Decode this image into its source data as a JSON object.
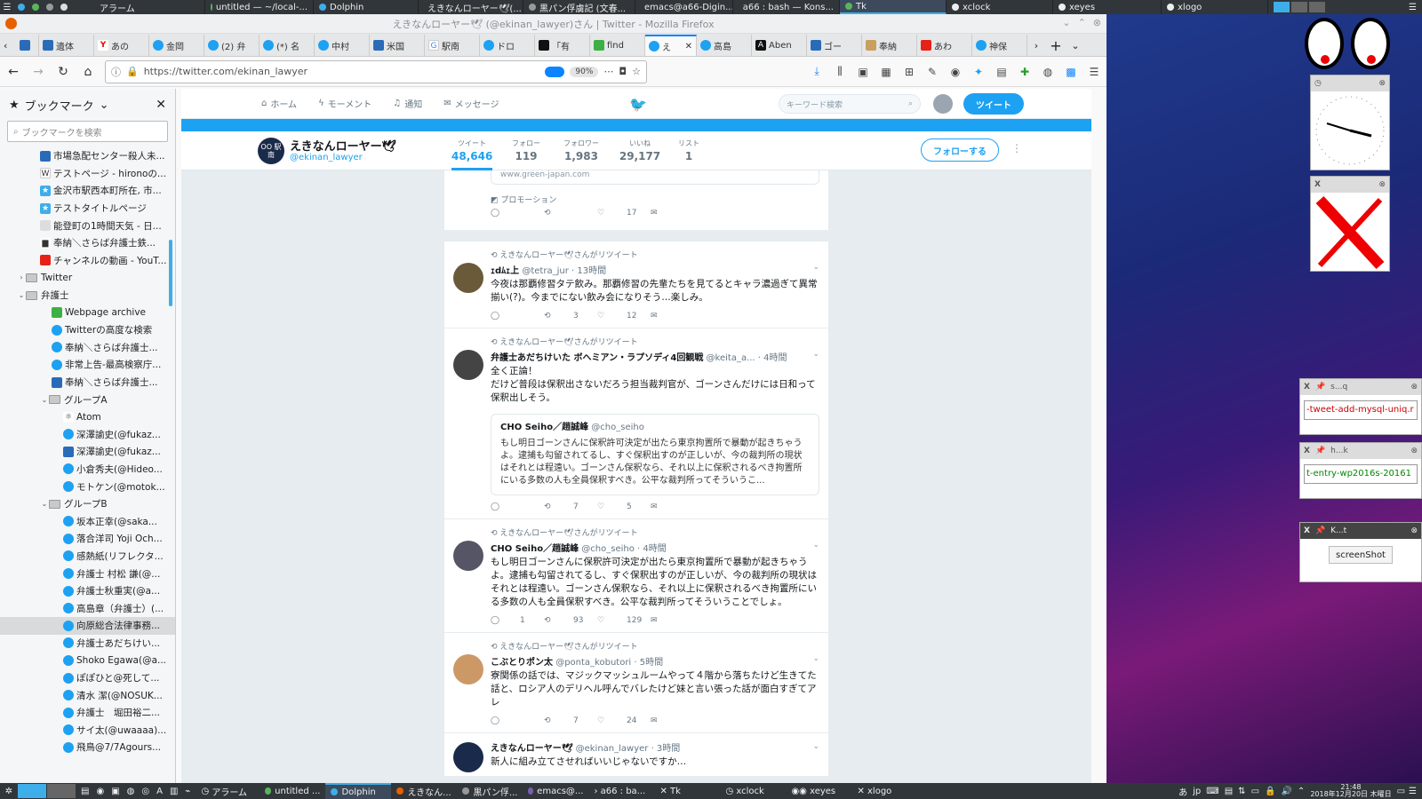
{
  "top_panel": {
    "tasks": [
      {
        "label": "アラーム"
      },
      {
        "label": "untitled — ~/local-..."
      },
      {
        "label": "Dolphin"
      },
      {
        "label": "えきなんローヤー🕊(..."
      },
      {
        "label": "黒パン俘虜記 (文春..."
      },
      {
        "label": "emacs@a66-Digin..."
      },
      {
        "label": "a66 : bash — Kons..."
      },
      {
        "label": "Tk"
      },
      {
        "label": "xclock"
      },
      {
        "label": "xeyes"
      },
      {
        "label": "xlogo"
      }
    ]
  },
  "firefox": {
    "title": "えきなんローヤー🕊 (@ekinan_lawyer)さん | Twitter - Mozilla Firefox",
    "tabs": [
      {
        "label": "遺体"
      },
      {
        "label": "あの"
      },
      {
        "label": "金岡"
      },
      {
        "label": "(2) 弁"
      },
      {
        "label": "(*) 名"
      },
      {
        "label": "中村"
      },
      {
        "label": "米国"
      },
      {
        "label": "駅南"
      },
      {
        "label": "ドロ"
      },
      {
        "label": "「有"
      },
      {
        "label": "find"
      },
      {
        "label": "え"
      },
      {
        "label": "高島"
      },
      {
        "label": "Aben"
      },
      {
        "label": "ゴー"
      },
      {
        "label": "奉納"
      },
      {
        "label": "あわ"
      },
      {
        "label": "神保"
      }
    ],
    "url": "https://twitter.com/ekinan_lawyer",
    "zoom": "90%"
  },
  "sidebar": {
    "title": "ブックマーク",
    "search_placeholder": "ブックマークを検索",
    "items": [
      {
        "label": "市場急配センター殺人未..."
      },
      {
        "label": "テストページ - hironoの..."
      },
      {
        "label": "金沢市駅西本町所在, 市..."
      },
      {
        "label": "テストタイトルページ"
      },
      {
        "label": "能登町の1時間天気 - 日..."
      },
      {
        "label": "奉納＼さらば弁護士鉄..."
      },
      {
        "label": "チャンネルの動画 - YouT..."
      },
      {
        "label": "Twitter"
      },
      {
        "label": "弁護士"
      },
      {
        "label": "Webpage archive"
      },
      {
        "label": "Twitterの高度な検索"
      },
      {
        "label": "奉納＼さらば弁護士..."
      },
      {
        "label": "非常上告-最高検察庁..."
      },
      {
        "label": "奉納＼さらば弁護士..."
      },
      {
        "label": "グループA"
      },
      {
        "label": "Atom"
      },
      {
        "label": "深澤諭史(@fukaz..."
      },
      {
        "label": "深澤諭史(@fukaz..."
      },
      {
        "label": "小倉秀夫(@Hideo..."
      },
      {
        "label": "モトケン(@motok..."
      },
      {
        "label": "グループB"
      },
      {
        "label": "坂本正幸(@saka..."
      },
      {
        "label": "落合洋司 Yoji Och..."
      },
      {
        "label": "感熱紙(リフレクタ..."
      },
      {
        "label": "弁護士 村松 謙(@..."
      },
      {
        "label": "弁護士秋重実(@a..."
      },
      {
        "label": "高島章（弁護士）(..."
      },
      {
        "label": "向原総合法律事務..."
      },
      {
        "label": "弁護士あだちけい..."
      },
      {
        "label": "Shoko Egawa(@a..."
      },
      {
        "label": "ぽぽひと@死して..."
      },
      {
        "label": "清水 潔(@NOSUK..."
      },
      {
        "label": "弁護士　堀田裕二..."
      },
      {
        "label": "サイ太(@uwaaaa)..."
      },
      {
        "label": "飛鳥@7/7Agours..."
      }
    ]
  },
  "twitter": {
    "nav": {
      "home": "ホーム",
      "moments": "モーメント",
      "notifications": "通知",
      "messages": "メッセージ"
    },
    "search_placeholder": "キーワード検索",
    "tweet_button": "ツイート",
    "profile": {
      "name": "えきなんローヤー🕊",
      "handle": "@ekinan_lawyer",
      "avatar_text": "OO 駅南",
      "stats": [
        {
          "label": "ツイート",
          "value": "48,646"
        },
        {
          "label": "フォロー",
          "value": "119"
        },
        {
          "label": "フォロワー",
          "value": "1,983"
        },
        {
          "label": "いいね",
          "value": "29,177"
        },
        {
          "label": "リスト",
          "value": "1"
        }
      ],
      "follow_button": "フォローする"
    },
    "promo": {
      "url": "www.green-japan.com",
      "label": "プロモーション",
      "likes": "17"
    },
    "tweets": [
      {
        "retweet": "えきなんローヤー🕊さんがリツイート",
        "name": "ｪdﾑｪ上",
        "handle": "@tetra_jur",
        "time": "· 13時間",
        "text": "今夜は那覇修習タテ飲み。那覇修習の先輩たちを見てるとキャラ濃過ぎて異常揃い(?)。今までにない飲み会になりそう…楽しみ。",
        "replies": "",
        "retweets": "3",
        "likes": "12"
      },
      {
        "retweet": "えきなんローヤー🕊さんがリツイート",
        "name": "弁護士あだちけいた ボヘミアン・ラプソディ4回観戦",
        "handle": "@keita_a...",
        "time": "· 4時間",
        "text": "全く正論！\nだけど普段は保釈出さないだろう担当裁判官が、ゴーンさんだけには日和って保釈出しそう。",
        "quote_name": "CHO Seiho／趙誠峰",
        "quote_handle": "@cho_seiho",
        "quote_text": "もし明日ゴーンさんに保釈許可決定が出たら東京拘置所で暴動が起きちゃうよ。逮捕も勾留されてるし、すぐ保釈出すのが正しいが、今の裁判所の現状はそれとは程遠い。ゴーンさん保釈なら、それ以上に保釈されるべき拘置所にいる多数の人も全員保釈すべき。公平な裁判所ってそういうこ...",
        "replies": "",
        "retweets": "7",
        "likes": "5"
      },
      {
        "retweet": "えきなんローヤー🕊さんがリツイート",
        "name": "CHO Seiho／趙誠峰",
        "handle": "@cho_seiho",
        "time": "· 4時間",
        "text": "もし明日ゴーンさんに保釈許可決定が出たら東京拘置所で暴動が起きちゃうよ。逮捕も勾留されてるし、すぐ保釈出すのが正しいが、今の裁判所の現状はそれとは程遠い。ゴーンさん保釈なら、それ以上に保釈されるべき拘置所にいる多数の人も全員保釈すべき。公平な裁判所ってそういうことでしょ。",
        "replies": "1",
        "retweets": "93",
        "likes": "129"
      },
      {
        "retweet": "えきなんローヤー🕊さんがリツイート",
        "name": "こぶとりポン太",
        "handle": "@ponta_kobutori",
        "time": "· 5時間",
        "text": "寮関係の話では、マジックマッシュルームやって４階から落ちたけど生きてた話と、ロシア人のデリヘル呼んでバレたけど妹と言い張った話が面白すぎてアレ",
        "replies": "",
        "retweets": "7",
        "likes": "24"
      },
      {
        "retweet": "",
        "name": "えきなんローヤー🕊",
        "handle": "@ekinan_lawyer",
        "time": "· 3時間",
        "text": "新人に組み立てさせればいいじゃないですか…",
        "replies": "",
        "retweets": "",
        "likes": ""
      }
    ]
  },
  "widgets": {
    "kt_title": "K...t",
    "screenshot_button": "screenShot",
    "field1": "-tweet-add-mysql-uniq.r",
    "field2": "t-entry-wp2016s-20161",
    "w1_title": "s...q",
    "w2_title": "h...k"
  },
  "bottom_panel": {
    "tasks": [
      {
        "label": "アラーム"
      },
      {
        "label": "untitled ..."
      },
      {
        "label": "Dolphin"
      },
      {
        "label": "えきなん..."
      },
      {
        "label": "黒パン俘..."
      },
      {
        "label": "emacs@..."
      },
      {
        "label": "a66 : ba..."
      },
      {
        "label": "Tk"
      },
      {
        "label": "xclock"
      },
      {
        "label": "xeyes"
      },
      {
        "label": "xlogo"
      }
    ],
    "lang": "jp",
    "time": "21:48",
    "date": "2018年12月20日 木曜日"
  }
}
